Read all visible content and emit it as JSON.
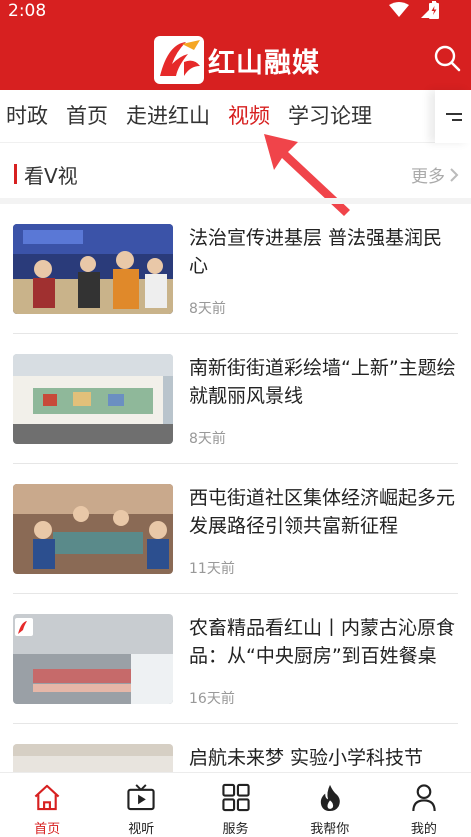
{
  "status_bar": {
    "time": "2:08",
    "icons": [
      "wifi-icon",
      "signal-icon",
      "battery-icon"
    ]
  },
  "header": {
    "app_name": "红山融媒",
    "search_icon": "search-icon",
    "brand_color": "#d72020"
  },
  "tabs": {
    "items": [
      {
        "label": "时政"
      },
      {
        "label": "首页"
      },
      {
        "label": "走进红山"
      },
      {
        "label": "视频",
        "active": true
      },
      {
        "label": "学习论理"
      }
    ],
    "menu_icon": "menu-icon"
  },
  "section": {
    "title": "看V视",
    "more": "更多"
  },
  "news": [
    {
      "title": "法治宣传进基层  普法强基润民心",
      "time": "8天前"
    },
    {
      "title": "南新街街道彩绘墙“上新”主题绘就靓丽风景线",
      "time": "8天前"
    },
    {
      "title": "西屯街道社区集体经济崛起多元发展路径引领共富新征程",
      "time": "11天前"
    },
    {
      "title": "农畜精品看红山丨内蒙古沁原食品：从“中央厨房”到百姓餐桌",
      "time": "16天前"
    },
    {
      "title": "启航未来梦  实验小学科技节",
      "time": ""
    }
  ],
  "bottom_nav": [
    {
      "label": "首页",
      "icon": "home-icon",
      "active": true
    },
    {
      "label": "视听",
      "icon": "tv-icon"
    },
    {
      "label": "服务",
      "icon": "grid-icon"
    },
    {
      "label": "我帮你",
      "icon": "flame-icon"
    },
    {
      "label": "我的",
      "icon": "user-icon"
    }
  ]
}
